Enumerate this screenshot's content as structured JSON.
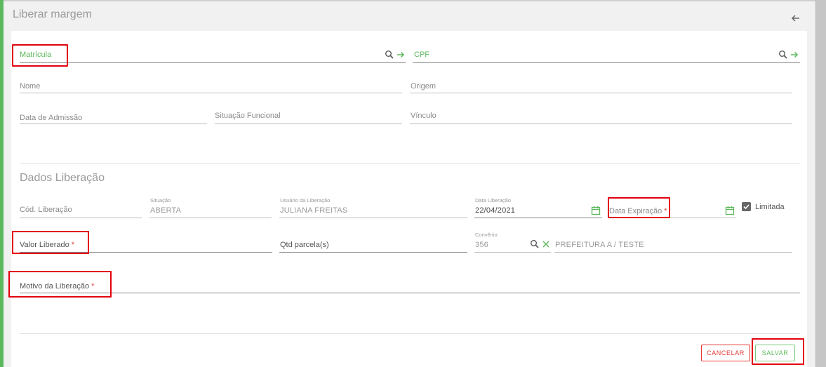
{
  "page": {
    "title": "Liberar margem"
  },
  "search": {
    "matricula_label": "Matrícula",
    "cpf_label": "CPF"
  },
  "person": {
    "nome_label": "Nome",
    "origem_label": "Origem",
    "admissao_label": "Data de Admissão",
    "situacao_funcional_label": "Situação Funcional",
    "vinculo_label": "Vínculo"
  },
  "liberacao": {
    "section_title": "Dados Liberação",
    "cod_label": "Cód. Liberação",
    "situacao_label": "Situação",
    "situacao_value": "ABERTA",
    "usuario_label": "Usuário da Liberação",
    "usuario_value": "JULIANA FREITAS",
    "data_label": "Data Liberação",
    "data_value": "22/04/2021",
    "expiracao_label": "Data Expiração",
    "limitada_label": "Limitada",
    "limitada_checked": true,
    "valor_label": "Valor Liberado",
    "parcelas_label": "Qtd parcela(s)",
    "convenio_label": "Convênio",
    "convenio_code": "356",
    "convenio_name": "PREFEITURA A / TESTE",
    "motivo_label": "Motivo da Liberação",
    "required_mark": "*"
  },
  "actions": {
    "cancel_label": "CANCELAR",
    "save_label": "SALVAR"
  },
  "colors": {
    "accent": "#5cb85c",
    "danger": "#e53935",
    "highlight": "#e3000f"
  }
}
